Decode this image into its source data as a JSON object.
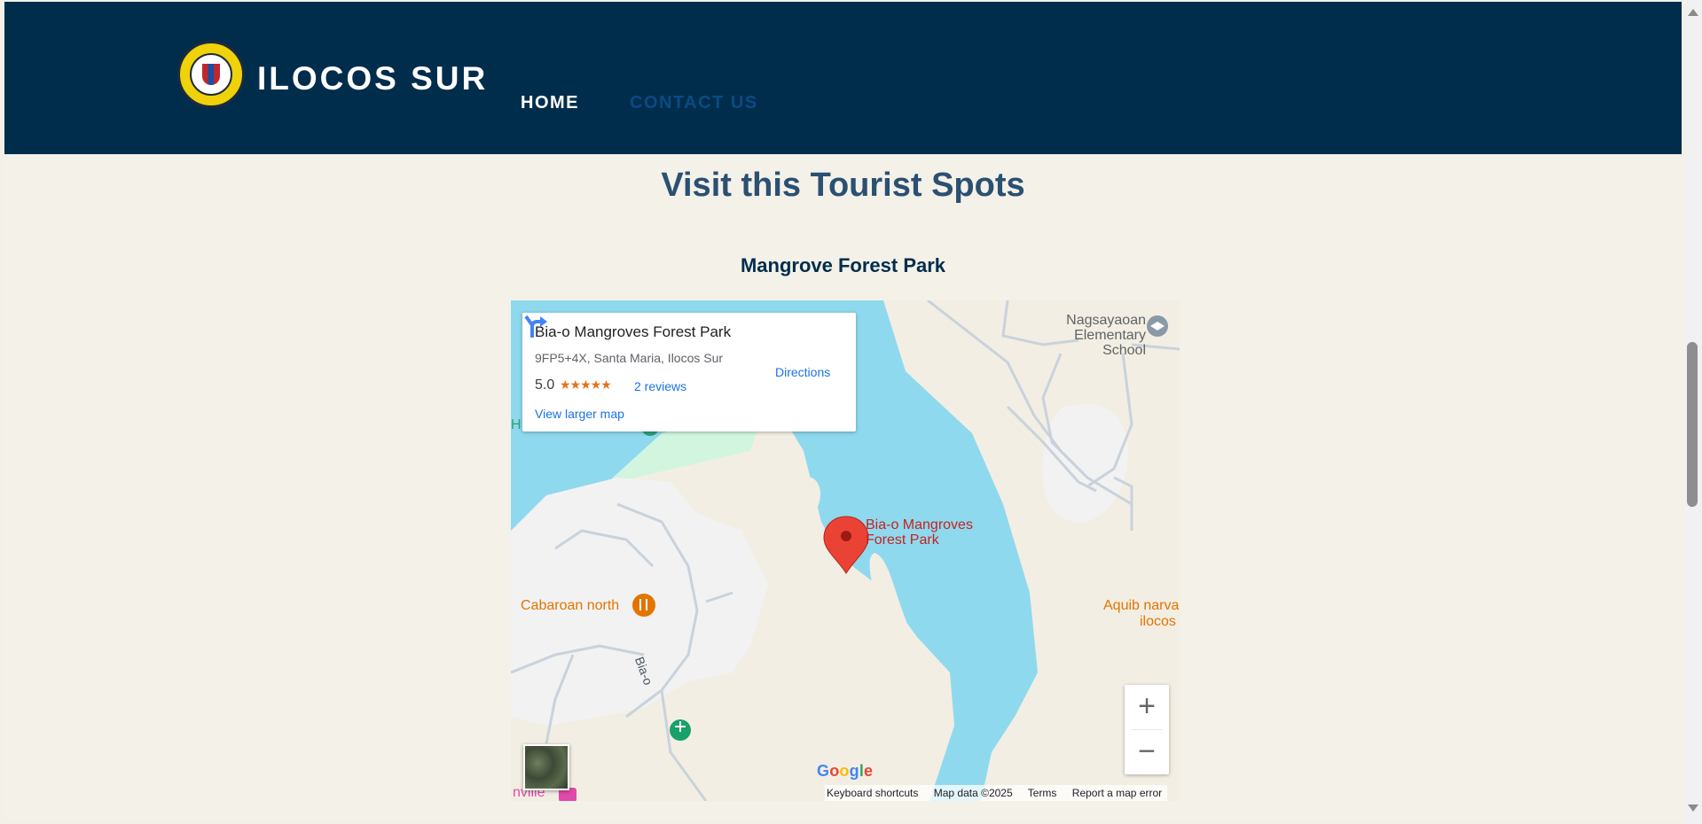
{
  "header": {
    "brand": "ILOCOS SUR",
    "logo_text": "PROVINCE OF ILOCOS SUR · OFFICIAL SEAL",
    "nav": {
      "home": "HOME",
      "contact": "CONTACT US"
    }
  },
  "main": {
    "section_title": "Visit this Tourist Spots",
    "spot_title": "Mangrove Forest Park"
  },
  "map": {
    "card": {
      "name": "Bia-o Mangroves Forest Park",
      "address": "9FP5+4X, Santa Maria, Ilocos Sur",
      "rating": "5.0",
      "stars": "★★★★★",
      "reviews": "2 reviews",
      "larger_map": "View larger map",
      "directions": "Directions"
    },
    "labels": {
      "school": "Nagsayaoan Elementary School",
      "pin_line1": "Bia-o Mangroves",
      "pin_line2": "Forest Park",
      "restaurant": "Cabaroan north",
      "aquib_line1": "Aquib narva",
      "aquib_line2": "ilocos",
      "road": "Bia-o",
      "partial_bottom": "nville",
      "partial_left": "H"
    },
    "zoom": {
      "in": "+",
      "out": "−"
    },
    "google": {
      "G": "G",
      "o1": "o",
      "o2": "o",
      "g": "g",
      "l": "l",
      "e": "e"
    },
    "attribution": {
      "keyboard": "Keyboard shortcuts",
      "mapdata": "Map data ©2025",
      "terms": "Terms",
      "report": "Report a map error"
    },
    "colors": {
      "water": "#8fd9ee",
      "land": "#f3eee3",
      "urban": "#f2f2f2",
      "park": "#d2f5e0",
      "pin": "#ea4335",
      "pin_label": "#c5221f",
      "food": "#e37400"
    }
  },
  "theme": {
    "header_bg": "#012d4d",
    "page_bg": "#f4f1e8",
    "title_color": "#2a5072"
  }
}
